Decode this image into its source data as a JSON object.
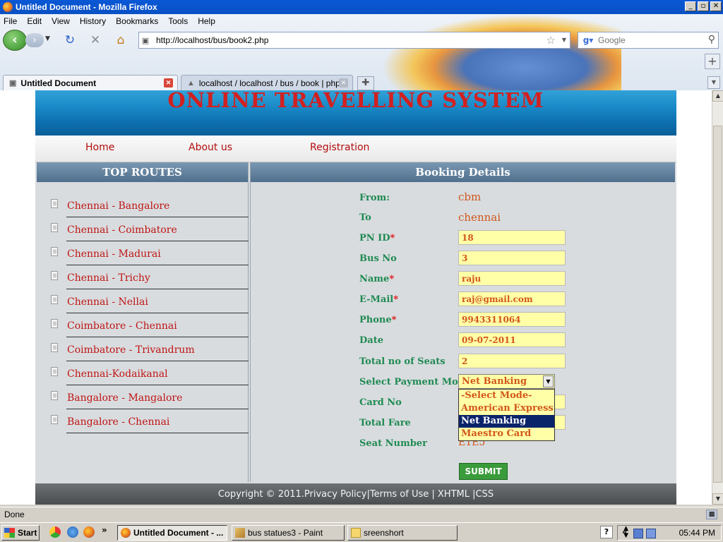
{
  "window": {
    "title": "Untitled Document - Mozilla Firefox",
    "min_label": "_",
    "max_label": "▫",
    "close_label": "✕"
  },
  "menu": [
    "File",
    "Edit",
    "View",
    "History",
    "Bookmarks",
    "Tools",
    "Help"
  ],
  "nav": {
    "url": "http://localhost/bus/book2.php",
    "search_placeholder": "Google"
  },
  "tabs": [
    {
      "label": "Untitled Document"
    },
    {
      "label": "localhost / localhost / bus / book | php..."
    }
  ],
  "site": {
    "title": "ONLINE TRAVELLING SYSTEM",
    "nav": [
      "Home",
      "About us",
      "Registration"
    ]
  },
  "routes": {
    "heading": "TOP ROUTES",
    "items": [
      "Chennai - Bangalore",
      "Chennai - Coimbatore",
      "Chennai - Madurai",
      "Chennai - Trichy",
      "Chennai - Nellai",
      "Coimbatore - Chennai",
      "Coimbatore - Trivandrum",
      "Chennai-Kodaikanal",
      "Bangalore - Mangalore",
      "Bangalore - Chennai"
    ]
  },
  "booking": {
    "heading": "Booking Details",
    "from_label": "From:",
    "from_value": "cbm",
    "to_label": "To",
    "to_value": "chennai",
    "pnid_label": "PN ID",
    "pnid_value": "18",
    "busno_label": "Bus No",
    "busno_value": "3",
    "name_label": "Name",
    "name_value": "raju",
    "email_label": "E-Mail",
    "email_value": "raj@gmail.com",
    "phone_label": "Phone",
    "phone_value": "9943311064",
    "date_label": "Date",
    "date_value": "09-07-2011",
    "seats_label": "Total no of Seats",
    "seats_value": "2",
    "payment_label": "Select Payment Mode",
    "payment_value": "Net Banking",
    "payment_options": [
      "-Select Mode-",
      "American Express",
      "Net Banking",
      "Maestro Card"
    ],
    "cardno_label": "Card No",
    "fare_label": "Total Fare",
    "seatnum_label": "Seat Number",
    "seatnum_value": "E1E5",
    "required_mark": "*",
    "submit_label": "SUBMIT"
  },
  "footer": {
    "text": "Copyright © 2011.Privacy Policy|Terms of Use | XHTML |CSS"
  },
  "status": {
    "text": "Done"
  },
  "taskbar": {
    "start_label": "Start",
    "more_label": "»",
    "tasks": [
      "Untitled Document - ...",
      "bus statues3 - Paint",
      "sreenshort"
    ],
    "tray_chevron": "«",
    "help_label": "?",
    "clock": "05:44 PM"
  }
}
